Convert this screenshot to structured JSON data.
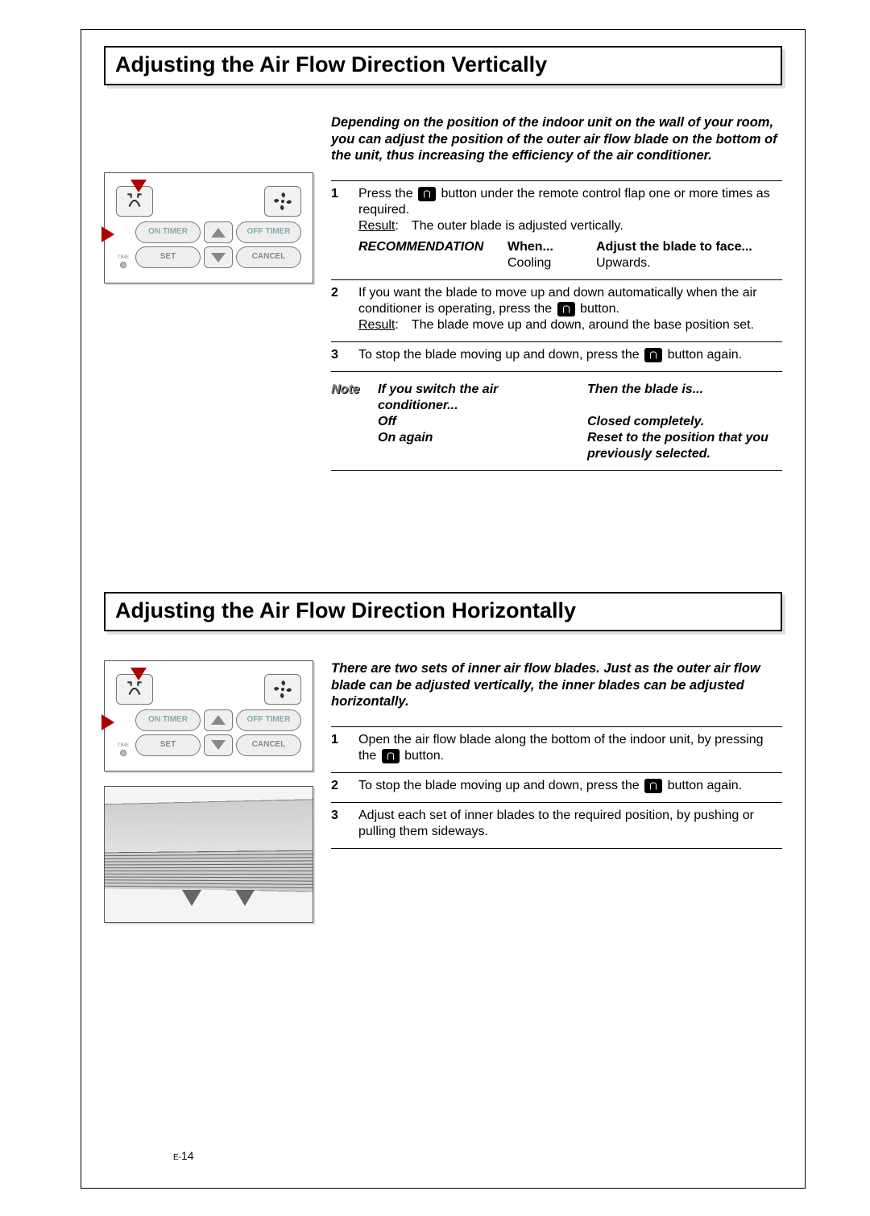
{
  "section1": {
    "title": "Adjusting the Air Flow Direction Vertically",
    "intro": "Depending on the position of the indoor unit on the wall of your room, you can adjust the position of the outer air flow blade on the bottom of the unit, thus increasing the efficiency of the air conditioner.",
    "step1": {
      "num": "1",
      "line1a": "Press the ",
      "line1b": " button under the remote control flap one or more times as required.",
      "result_label": "Result",
      "result_text": ": The outer blade is adjusted vertically."
    },
    "rec": {
      "label": "RECOMMENDATION",
      "when_head": "When...",
      "when_val": "Cooling",
      "adj_head": "Adjust the blade to face...",
      "adj_val": "Upwards."
    },
    "step2": {
      "num": "2",
      "line_a": "If you want the blade to move up and down automatically when the air conditioner is operating, press the ",
      "line_b": " button.",
      "result_label": "Result",
      "result_text": ": The blade move up and down, around the base position set."
    },
    "step3": {
      "num": "3",
      "line_a": "To stop the blade moving up and down, press the ",
      "line_b": " button again."
    },
    "note": {
      "label": "Note",
      "head_l": "If you switch the air conditioner...",
      "head_r": "Then the blade is...",
      "r1_l": "Off",
      "r1_r": "Closed completely.",
      "r2_l": "On again",
      "r2_r": "Reset to the position that you previously selected."
    },
    "remote": {
      "on_timer": "ON TIMER",
      "off_timer": "OFF TIMER",
      "set": "SET",
      "cancel": "CANCEL",
      "time": "TIME"
    }
  },
  "section2": {
    "title": "Adjusting the Air Flow Direction Horizontally",
    "intro": "There are two sets of inner air flow blades. Just as the outer air flow blade can be adjusted vertically, the inner blades can be adjusted horizontally.",
    "step1": {
      "num": "1",
      "line_a": "Open the air flow blade along the bottom of the indoor unit, by pressing the ",
      "line_b": " button."
    },
    "step2": {
      "num": "2",
      "line_a": "To stop the blade moving up and down, press the ",
      "line_b": " button again."
    },
    "step3": {
      "num": "3",
      "text": "Adjust each set of inner blades to the required position, by pushing or pulling them sideways."
    },
    "remote": {
      "on_timer": "ON TIMER",
      "off_timer": "OFF TIMER",
      "set": "SET",
      "cancel": "CANCEL",
      "time": "TIME"
    }
  },
  "page_num_prefix": "E-",
  "page_num": "14"
}
